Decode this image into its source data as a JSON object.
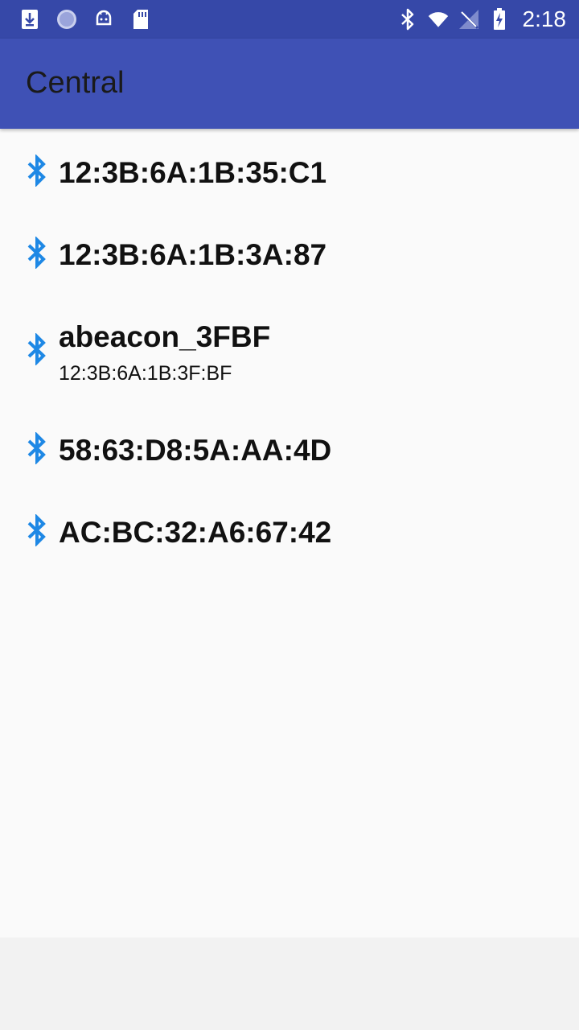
{
  "status_bar": {
    "time": "2:18",
    "left_icons": [
      "download-icon",
      "circle-icon",
      "android-icon",
      "sd-card-icon"
    ],
    "right_icons": [
      "bluetooth-icon",
      "wifi-icon",
      "no-signal-icon",
      "battery-charging-icon"
    ]
  },
  "app_bar": {
    "title": "Central",
    "color": "#3f51b5"
  },
  "devices": [
    {
      "name": "12:3B:6A:1B:35:C1",
      "address": ""
    },
    {
      "name": "12:3B:6A:1B:3A:87",
      "address": ""
    },
    {
      "name": "abeacon_3FBF",
      "address": "12:3B:6A:1B:3F:BF"
    },
    {
      "name": "58:63:D8:5A:AA:4D",
      "address": ""
    },
    {
      "name": "AC:BC:32:A6:67:42",
      "address": ""
    }
  ],
  "accent_color": "#1e88e5"
}
